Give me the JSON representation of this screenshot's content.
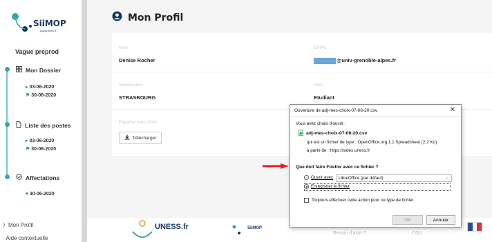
{
  "app": {
    "logo_text": "SiiMOP",
    "logo_sub": "Appariement"
  },
  "sidebar": {
    "vague": "Vague preprod",
    "sections": [
      {
        "title": "Mon Dossier",
        "icon": "grid-icon",
        "dates": [
          "03-06-2020",
          "30-06-2020"
        ]
      },
      {
        "title": "Liste des postes",
        "icon": "document-icon",
        "dates": [
          "03-06-2020",
          "30-06-2020"
        ]
      },
      {
        "title": "Affectations",
        "icon": "check-circle-icon",
        "dates": [
          "30-06-2020"
        ]
      }
    ],
    "footer_links": [
      "Mon Profil",
      "Aide contextuelle"
    ]
  },
  "page": {
    "title": "Mon Profil"
  },
  "profile": {
    "nom_label": "Nom",
    "nom": "Denise Rocher",
    "eppn_label": "EPPN",
    "eppn": "@univ-grenoble-alpes.fr",
    "subdivision_label": "Subdivision",
    "subdivision": "STRASBOURG",
    "role_label": "Rôle",
    "role": "Etudiant",
    "export_label": "Exporter mes choix",
    "download_label": "Télécharger"
  },
  "footer": {
    "uness": "UNESS.fr",
    "siimop": "SiiMOP",
    "help": "Besoin d'aide ?",
    "cgu": "CGU"
  },
  "dialog": {
    "title": "Ouverture de adj-mes-choix-07-06-20.csv",
    "intro": "Vous avez choisi d'ouvrir :",
    "filename": "adj-mes-choix-07-06-20.csv",
    "filetype": "qui est un fichier de type : OpenOffice.org 1.1 Spreadsheet (2,2 Ko)",
    "source": "à partir de : https://sides.uness.fr",
    "question": "Que doit faire Firefox avec ce fichier ?",
    "open_with_label": "Ouvrir avec",
    "open_with_app": "LibreOffice (par défaut)",
    "save_label": "Enregistrer le fichier",
    "always_label": "Toujours effectuer cette action pour ce type de fichier.",
    "ok": "OK",
    "cancel": "Annuler",
    "selected_option": "save"
  },
  "colors": {
    "accent": "#3aa7a1",
    "brand": "#16365f",
    "arrow": "#e02020"
  }
}
